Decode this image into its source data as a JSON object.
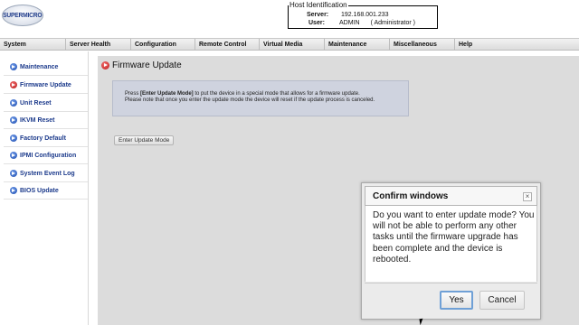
{
  "header": {
    "logo_text": "SUPERMICRO",
    "host_identification": {
      "legend": "Host Identification",
      "server_label": "Server:",
      "server_value": "192.168.001.233",
      "user_label": "User:",
      "user_value": "ADMIN",
      "user_role": "( Administrator )"
    }
  },
  "menu": {
    "items": [
      {
        "label": "System"
      },
      {
        "label": "Server Health"
      },
      {
        "label": "Configuration"
      },
      {
        "label": "Remote Control"
      },
      {
        "label": "Virtual Media"
      },
      {
        "label": "Maintenance"
      },
      {
        "label": "Miscellaneous"
      },
      {
        "label": "Help"
      }
    ]
  },
  "sidebar": {
    "items": [
      {
        "label": "Maintenance",
        "icon": "blue-arrow-icon",
        "active": false
      },
      {
        "label": "Firmware Update",
        "icon": "red-arrow-icon",
        "active": true
      },
      {
        "label": "Unit Reset",
        "icon": "blue-arrow-icon",
        "active": false
      },
      {
        "label": "IKVM Reset",
        "icon": "blue-arrow-icon",
        "active": false
      },
      {
        "label": "Factory Default",
        "icon": "blue-arrow-icon",
        "active": false
      },
      {
        "label": "IPMI Configuration",
        "icon": "blue-arrow-icon",
        "active": false
      },
      {
        "label": "System Event Log",
        "icon": "blue-arrow-icon",
        "active": false
      },
      {
        "label": "BIOS Update",
        "icon": "blue-arrow-icon",
        "active": false
      }
    ]
  },
  "main": {
    "title": "Firmware Update",
    "info": {
      "line1_prefix": "Press ",
      "line1_bold": "[Enter Update Mode]",
      "line1_suffix": " to put the device in a special mode that allows for a firmware update.",
      "line2": "Please note that once you enter the update mode the device will reset if the update process is canceled."
    },
    "enter_button": "Enter Update Mode"
  },
  "dialog": {
    "title": "Confirm windows",
    "close_glyph": "×",
    "message": "Do you want to enter update mode? You will not be able to perform any other tasks until the firmware upgrade has been complete and the device is rebooted.",
    "yes_label": "Yes",
    "cancel_label": "Cancel"
  },
  "colors": {
    "menu_bg": "#dcdcdc",
    "main_bg": "#dcdcdc",
    "info_bg": "#cfd3df",
    "sidebar_link": "#1d3b8c",
    "active_icon": "#c01d1d",
    "focus_border": "#6fa0d6"
  }
}
